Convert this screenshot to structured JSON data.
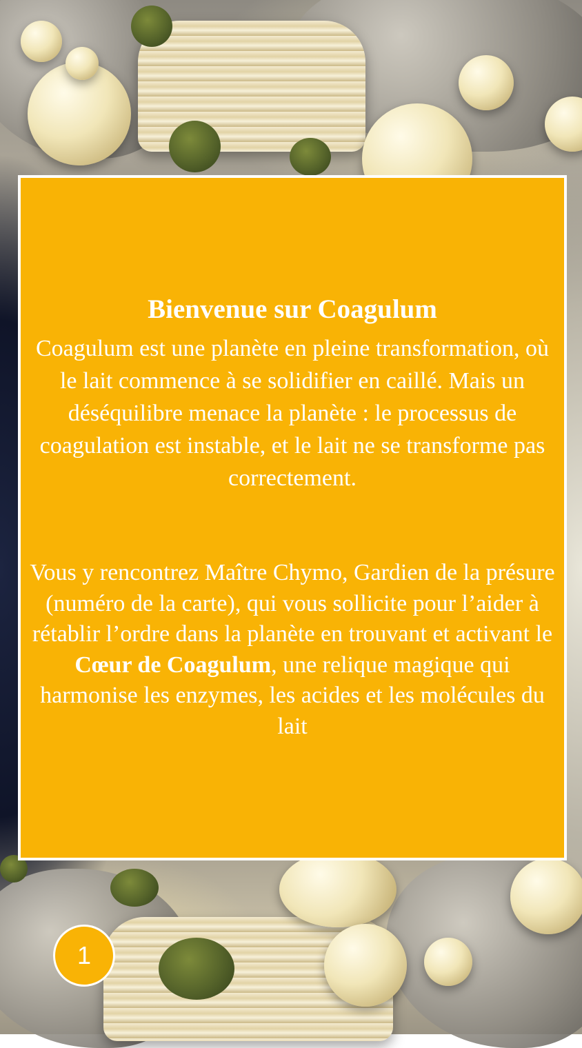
{
  "card": {
    "title": "Bienvenue sur Coagulum",
    "paragraph1": "Coagulum est une planète en pleine transformation, où le lait commence à se solidifier en caillé. Mais un déséquilibre menace la planète : le processus de coagulation est instable, et le lait ne se transforme pas correctement.",
    "paragraph2_before": "Vous y rencontrez Maître Chymo, Gardien de la présure (numéro de la carte), qui vous sollicite pour l’aider à rétablir l’ordre dans la planète en trouvant et activant le ",
    "paragraph2_bold": "Cœur de Coagulum",
    "paragraph2_after": ", une relique magique qui harmonise les enzymes, les acides et les molécules du lait"
  },
  "page_number": "1",
  "colors": {
    "card_background": "#f9b305",
    "card_border": "#ffffff",
    "text": "#ffffff"
  }
}
